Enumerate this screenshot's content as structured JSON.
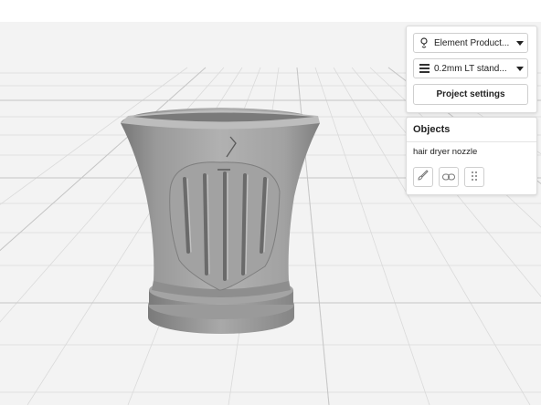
{
  "settings": {
    "printer": {
      "label": "Element Product...",
      "icon": "printer-pin-icon"
    },
    "profile": {
      "label": "0.2mm LT stand...",
      "icon": "layers-icon"
    },
    "project_settings_label": "Project settings"
  },
  "objects_panel": {
    "title": "Objects",
    "items": [
      "hair dryer nozzle"
    ],
    "tools": [
      "paintbrush-icon",
      "link-icon",
      "drag-handle-icon"
    ]
  },
  "colors": {
    "model": "#8f8f8f",
    "grid_line": "#d6d6d6",
    "bed": "#f3f3f3"
  }
}
